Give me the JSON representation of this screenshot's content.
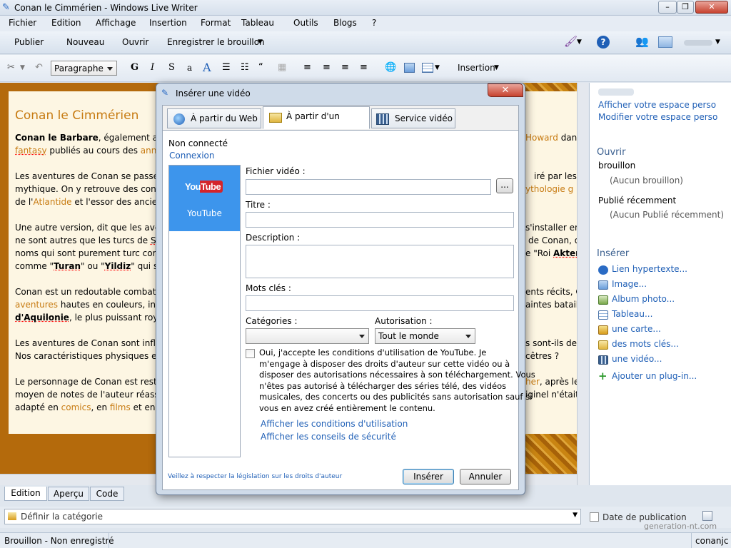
{
  "window": {
    "title": "Conan le Cimmérien - Windows Live Writer"
  },
  "menu": [
    "Fichier",
    "Edition",
    "Affichage",
    "Insertion",
    "Format",
    "Tableau",
    "Outils",
    "Blogs",
    "?"
  ],
  "toolbar": {
    "publish": "Publier",
    "new": "Nouveau",
    "open": "Ouvrir",
    "save_draft": "Enregistrer le brouillon",
    "paragraph": "Paragraphe",
    "insertion": "Insertion"
  },
  "editor": {
    "post_title": "Conan le Cimmérien",
    "l1a": "Conan le Barbare",
    ", ": "",
    "l1b": ", également app",
    "l1c": "Howard",
    "l1d": " dan",
    "l2a": "fantasy",
    "l2b": " publiés au cours des ",
    "l2c": "anné",
    "l3a": "Les aventures de Conan se passe",
    "l3b": "iré par les g",
    "l4a": "mythique. On y retrouve des cont",
    "l4b": "ythologie g",
    "l5a": "de l'",
    "l5b": "Atlantide",
    "l5c": " et l'essor des ancien",
    "l6a": "Une autre version, dit que les ave",
    "l6b": "s'installer en",
    "l7a": "ne sont autres que les turcs de ",
    "l7b": "Sy",
    "l7c": "de Conan, o",
    "l8a": "noms qui sont purement turc com",
    "l8b": "e \"Roi ",
    "l8c": "Akter",
    "l9a": "comme \"",
    "l9b": "Turan",
    "l9c": "\" ou \"",
    "l9d": "Yildiz",
    "l9e": "\" qui sig",
    "l10a": "Conan est un redoutable combatt",
    "l10b": "ents récits, C",
    "l11a": "aventures",
    "l11b": " hautes en couleurs, inclu",
    "l11c": "aintes batail",
    "l12a": "d'Aquilonie",
    "l12b": ", le plus puissant royau",
    "l12c": "",
    "l13a": "Les aventures de Conan sont influ",
    "l13b": "s sont-ils de",
    "l14a": "Nos caractéristiques physiques et",
    "l14b": "cêtres ?",
    "l15a": "Le personnage de Conan est reste",
    "l15b": "her",
    "l15c": ", après le",
    "l16a": "moyen de notes de l'auteur réass",
    "l16b": "iginel n'était",
    "l17a": "adapté en ",
    "l17b": "comics",
    "l17c": ", en ",
    "l17d": "films",
    "l17e": " et en j"
  },
  "sidebar": {
    "user_blur": "",
    "view_space": "Afficher votre espace perso",
    "edit_space": "Modifier votre espace perso",
    "open_heading": "Ouvrir",
    "drafts": "brouillon",
    "no_drafts": "(Aucun brouillon)",
    "recent": "Publié récemment",
    "no_recent": "(Aucun Publié récemment)",
    "insert_heading": "Insérer",
    "items": [
      "Lien hypertexte...",
      "Image...",
      "Album photo...",
      "Tableau...",
      "une carte...",
      "des mots clés...",
      "une vidéo...",
      "Ajouter un plug-in..."
    ]
  },
  "tabs": {
    "edit": "Edition",
    "preview": "Aperçu",
    "code": "Code"
  },
  "category": {
    "placeholder": "Définir la catégorie",
    "date": "Date de publication"
  },
  "status": {
    "left": "Brouillon - Non enregistré",
    "right": "conanjc"
  },
  "watermark": "generation-nt.com",
  "dialog": {
    "title": "Insérer une vidéo",
    "tabs": [
      "À partir du Web",
      "À partir d'un fichier",
      "Service vidéo"
    ],
    "not_connected": "Non connecté",
    "connect": "Connexion",
    "provider_logo": "YouTube",
    "provider_name": "YouTube",
    "video_file_label": "Fichier vidéo :",
    "browse": "...",
    "title_label": "Titre :",
    "description_label": "Description :",
    "keywords_label": "Mots clés :",
    "categories_label": "Catégories :",
    "categories_value": "",
    "permission_label": "Autorisation :",
    "permission_value": "Tout le monde",
    "terms_text": [
      "Oui, j'accepte les conditions d'utilisation de YouTube. Je",
      "m'engage à disposer des droits d'auteur sur cette vidéo ou à",
      "disposer des autorisations nécessaires à son téléchargement. Vous",
      "n'êtes pas autorisé à télécharger des séries télé, des vidéos",
      "musicales, des concerts ou des publicités sans autorisation sauf si",
      "vous en avez créé entièrement le contenu."
    ],
    "terms_link": "Afficher les conditions d'utilisation",
    "safety_link": "Afficher les conseils de sécurité",
    "footer_note": "Veillez à respecter la législation sur les droits d'auteur",
    "insert": "Insérer",
    "cancel": "Annuler"
  },
  "colors": {
    "accent": "#1f5fb6",
    "editor_bg": "#b46a0c",
    "link_orange": "#c77b12",
    "youtube_tile": "#3d95ec",
    "close_red": "#c7432f"
  }
}
